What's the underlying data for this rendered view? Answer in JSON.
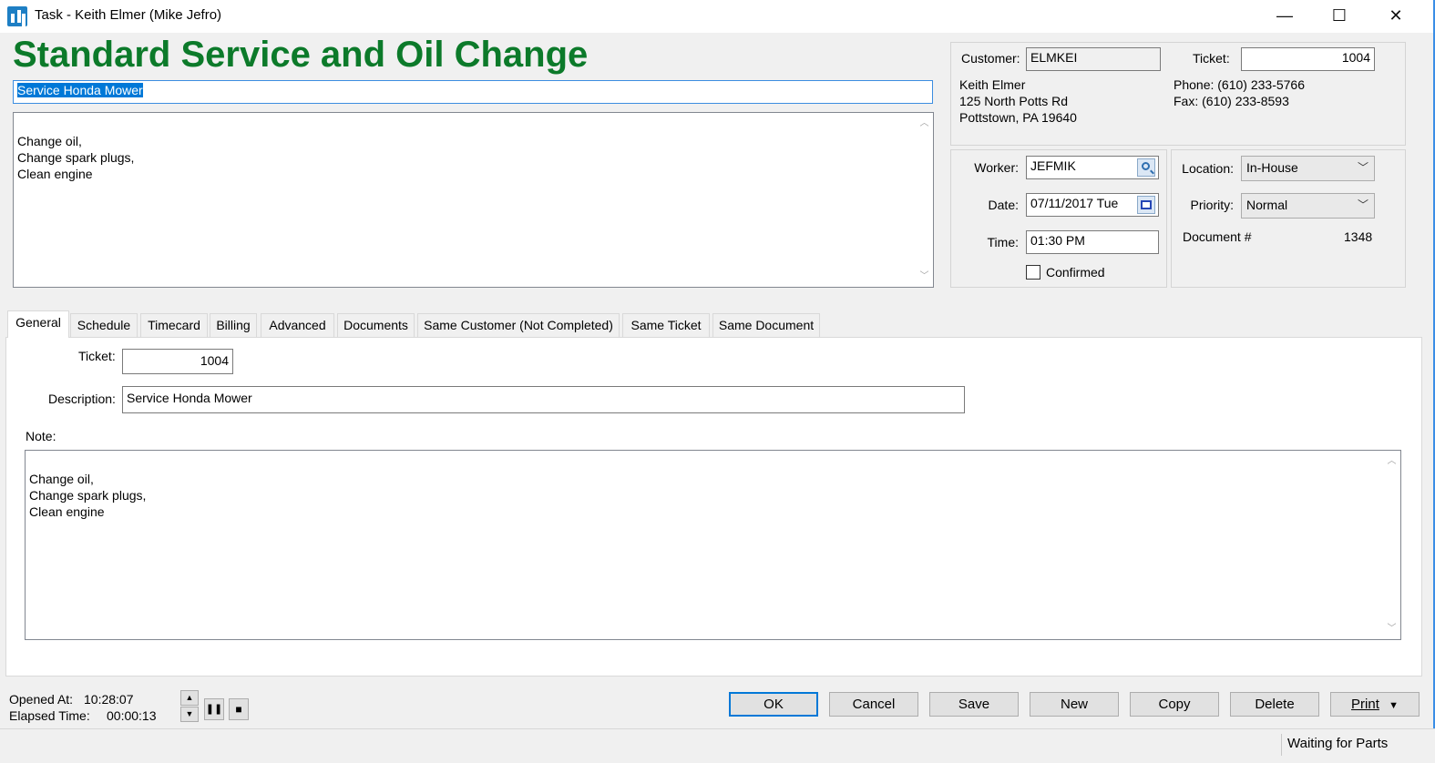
{
  "window": {
    "title": "Task - Keith Elmer (Mike Jefro)",
    "minimize": "—",
    "maximize": "☐",
    "close": "✕"
  },
  "header": {
    "title": "Standard Service and Oil Change",
    "description": "Service Honda Mower",
    "note": "Change oil,\nChange spark plugs,\nClean engine"
  },
  "customer": {
    "label": "Customer:",
    "code": "ELMKEI",
    "ticket_label": "Ticket:",
    "ticket": "1004",
    "name": "Keith Elmer",
    "address1": "125 North Potts Rd",
    "address2": "Pottstown, PA 19640",
    "phone": "Phone: (610) 233-5766",
    "fax": "Fax: (610) 233-8593"
  },
  "schedule": {
    "worker_label": "Worker:",
    "worker": "JEFMIK",
    "date_label": "Date:",
    "date": "07/11/2017 Tue",
    "time_label": "Time:",
    "time": "01:30 PM",
    "confirmed_label": "Confirmed"
  },
  "location": {
    "location_label": "Location:",
    "location": "In-House",
    "priority_label": "Priority:",
    "priority": "Normal",
    "document_label": "Document #",
    "document": "1348"
  },
  "tabs": [
    {
      "label": "General"
    },
    {
      "label": "Schedule"
    },
    {
      "label": "Timecard"
    },
    {
      "label": "Billing"
    },
    {
      "label": "Advanced"
    },
    {
      "label": "Documents"
    },
    {
      "label": "Same Customer (Not Completed)"
    },
    {
      "label": "Same Ticket"
    },
    {
      "label": "Same Document"
    }
  ],
  "general": {
    "ticket_label": "Ticket:",
    "ticket": "1004",
    "description_label": "Description:",
    "description": "Service Honda Mower",
    "note_label": "Note:",
    "note": "Change oil,\nChange spark plugs,\nClean engine"
  },
  "footer": {
    "opened_label": "Opened At:",
    "opened": "10:28:07",
    "elapsed_label": "Elapsed Time:",
    "elapsed": "00:00:13",
    "buttons": {
      "ok": "OK",
      "cancel": "Cancel",
      "save": "Save",
      "new": "New",
      "copy": "Copy",
      "delete": "Delete",
      "print": "Print"
    },
    "status": "Waiting for Parts"
  }
}
